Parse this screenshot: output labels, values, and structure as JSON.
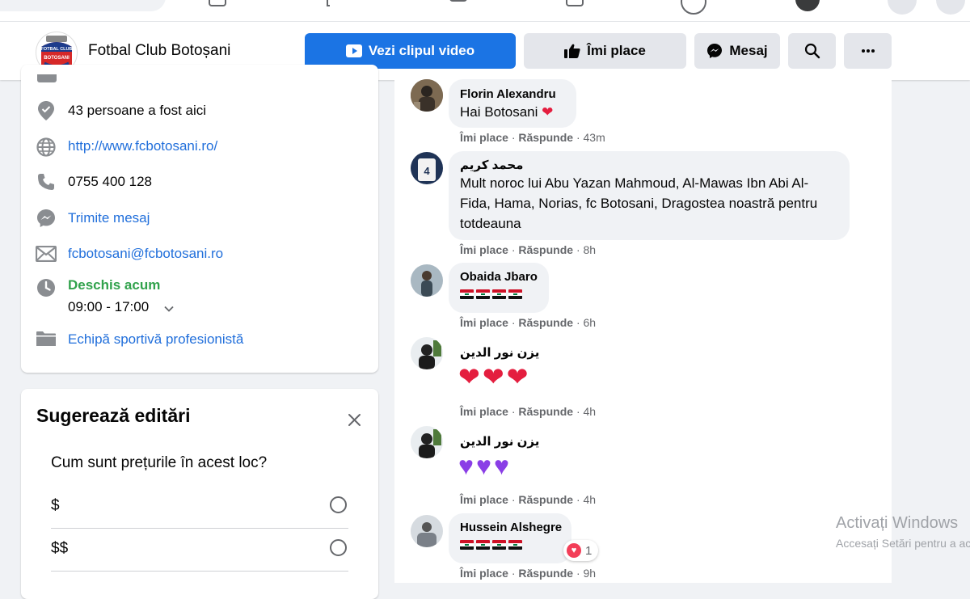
{
  "page": {
    "name": "Fotbal Club Botoșani",
    "logo_text_top": "FOTBAL CLUB",
    "logo_text_bottom": "BOTOSANI"
  },
  "header_buttons": {
    "video": "Vezi clipul video",
    "like": "Îmi place",
    "message": "Mesaj"
  },
  "icons": {
    "video": "video-play-icon",
    "like": "thumbs-up-icon",
    "message": "messenger-icon",
    "search": "search-icon",
    "more": "more-dots-icon"
  },
  "about": {
    "checkins": "43 persoane a fost aici",
    "website": "http://www.fcbotosani.ro/",
    "phone": "0755 400 128",
    "send_message": "Trimite mesaj",
    "email": "fcbotosani@fcbotosani.ro",
    "open_status": "Deschis acum",
    "hours": "09:00 - 17:00",
    "category": "Echipă sportivă profesionistă"
  },
  "suggest": {
    "title": "Sugerează editări",
    "question": "Cum sunt prețurile în acest loc?",
    "options": [
      "$",
      "$$"
    ]
  },
  "comment_actions": {
    "like": "Îmi place",
    "reply": "Răspunde",
    "sep": "·"
  },
  "comments": [
    {
      "author": "Florin Alexandru",
      "text": "Hai Botosani",
      "time": "43m"
    },
    {
      "author": "محمد كريم",
      "text": "Mult noroc lui Abu Yazan Mahmoud, Al-Mawas Ibn Abi Al-Fida, Hama, Norias, fc Botosani, Dragostea noastră pentru totdeauna",
      "time": "8h"
    },
    {
      "author": "Obaida Jbaro",
      "text": "",
      "time": "6h"
    },
    {
      "author": "يزن نور الدين",
      "text": "",
      "time": "4h"
    },
    {
      "author": "يزن نور الدين",
      "text": "",
      "time": "4h"
    },
    {
      "author": "Hussein Alshegre",
      "text": "",
      "time": "9h",
      "reactions": "1"
    }
  ],
  "watermark": {
    "title": "Activați Windows",
    "subtitle": "Accesați Setări pentru a ac"
  },
  "colors": {
    "primary": "#1b74e4",
    "link": "#216fdb",
    "open_green": "#31a24c",
    "bg": "#f0f2f5"
  }
}
